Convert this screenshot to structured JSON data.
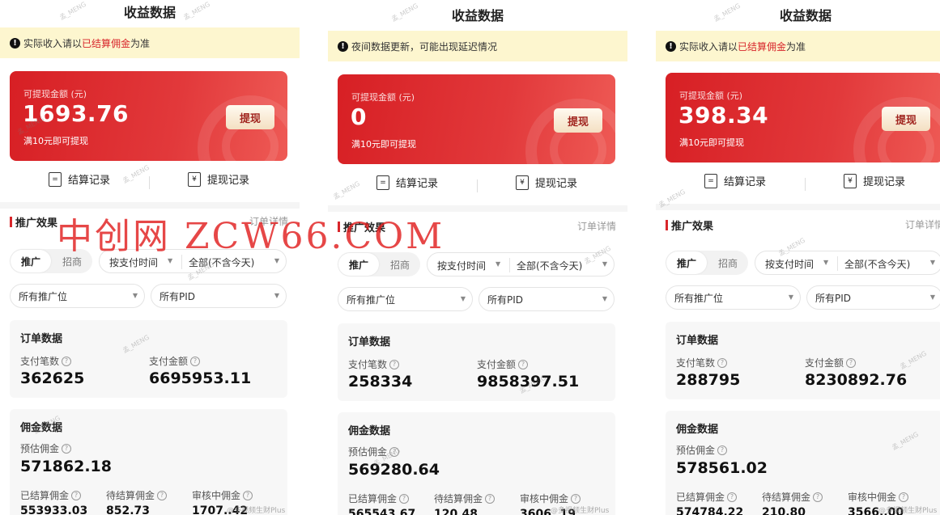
{
  "panels": [
    {
      "title": "收益数据",
      "notice": {
        "pre": "实际收入请以",
        "highlight": "已结算佣金",
        "post": "为准"
      },
      "balance_label": "可提现金额 (元)",
      "balance": "1693.76",
      "min_note": "满10元即可提现",
      "withdraw_button": "提现",
      "settle_record": "结算记录",
      "withdraw_record": "提现记录",
      "section_title": "推广效果",
      "order_detail": "订单详情",
      "toggle_promote": "推广",
      "toggle_recruit": "招商",
      "time_filter": "按支付时间",
      "range_filter": "全部(不含今天)",
      "position_filter": "所有推广位",
      "pid_filter": "所有PID",
      "order_section": "订单数据",
      "pay_count_label": "支付笔数",
      "pay_count": "362625",
      "pay_amount_label": "支付金额",
      "pay_amount": "6695953.11",
      "commission_section": "佣金数据",
      "estimated_label": "预估佣金",
      "estimated": "571862.18",
      "settled_label": "已结算佣金",
      "settled": "553933.03",
      "pending_label": "待结算佣金",
      "pending": "852.73",
      "review_label": "审核中佣金",
      "review": "1707..42"
    },
    {
      "title": "收益数据",
      "notice": {
        "pre": "夜间数据更新，可能出现延迟情况",
        "highlight": "",
        "post": ""
      },
      "balance_label": "可提现金额 (元)",
      "balance": "0",
      "min_note": "满10元即可提现",
      "withdraw_button": "提现",
      "settle_record": "结算记录",
      "withdraw_record": "提现记录",
      "section_title": "推广效果",
      "order_detail": "订单详情",
      "toggle_promote": "推广",
      "toggle_recruit": "招商",
      "time_filter": "按支付时间",
      "range_filter": "全部(不含今天)",
      "position_filter": "所有推广位",
      "pid_filter": "所有PID",
      "order_section": "订单数据",
      "pay_count_label": "支付笔数",
      "pay_count": "258334",
      "pay_amount_label": "支付金额",
      "pay_amount": "9858397.51",
      "commission_section": "佣金数据",
      "estimated_label": "预估佣金",
      "estimated": "569280.64",
      "settled_label": "已结算佣金",
      "settled": "565543.67",
      "pending_label": "待结算佣金",
      "pending": "120.48",
      "review_label": "审核中佣金",
      "review": "3606..19"
    },
    {
      "title": "收益数据",
      "notice": {
        "pre": "实际收入请以",
        "highlight": "已结算佣金",
        "post": "为准"
      },
      "balance_label": "可提现金额 (元)",
      "balance": "398.34",
      "min_note": "满10元即可提现",
      "withdraw_button": "提现",
      "settle_record": "结算记录",
      "withdraw_record": "提现记录",
      "section_title": "推广效果",
      "order_detail": "订单详情",
      "toggle_promote": "推广",
      "toggle_recruit": "招商",
      "time_filter": "按支付时间",
      "range_filter": "全部(不含今天)",
      "position_filter": "所有推广位",
      "pid_filter": "所有PID",
      "order_section": "订单数据",
      "pay_count_label": "支付笔数",
      "pay_count": "288795",
      "pay_amount_label": "支付金额",
      "pay_amount": "8230892.76",
      "commission_section": "佣金数据",
      "estimated_label": "预估佣金",
      "estimated": "578561.02",
      "settled_label": "已结算佣金",
      "settled": "574784.22",
      "pending_label": "待结算佣金",
      "pending": "210.80",
      "review_label": "审核中佣金",
      "review": "3566..00"
    }
  ],
  "watermark": "中创网 ZCW66.COM",
  "overlay_mark": "孟_MENG",
  "footer_mark": "@多视频生财Plus",
  "colors": {
    "accent": "#d8262b",
    "notice_bg": "#fdf6cf",
    "card_start": "#d71f24",
    "card_end": "#ee5a55"
  }
}
